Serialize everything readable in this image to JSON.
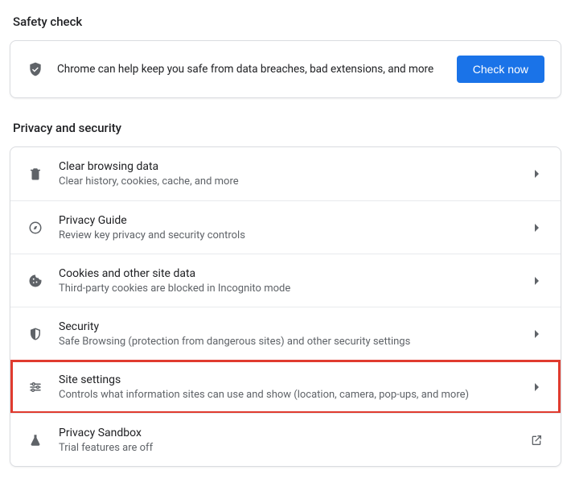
{
  "safety": {
    "heading": "Safety check",
    "message": "Chrome can help keep you safe from data breaches, bad extensions, and more",
    "button": "Check now"
  },
  "privacy": {
    "heading": "Privacy and security",
    "items": [
      {
        "title": "Clear browsing data",
        "sub": "Clear history, cookies, cache, and more",
        "trailing": "chevron"
      },
      {
        "title": "Privacy Guide",
        "sub": "Review key privacy and security controls",
        "trailing": "chevron"
      },
      {
        "title": "Cookies and other site data",
        "sub": "Third-party cookies are blocked in Incognito mode",
        "trailing": "chevron"
      },
      {
        "title": "Security",
        "sub": "Safe Browsing (protection from dangerous sites) and other security settings",
        "trailing": "chevron"
      },
      {
        "title": "Site settings",
        "sub": "Controls what information sites can use and show (location, camera, pop-ups, and more)",
        "trailing": "chevron",
        "highlight": true
      },
      {
        "title": "Privacy Sandbox",
        "sub": "Trial features are off",
        "trailing": "external"
      }
    ]
  }
}
